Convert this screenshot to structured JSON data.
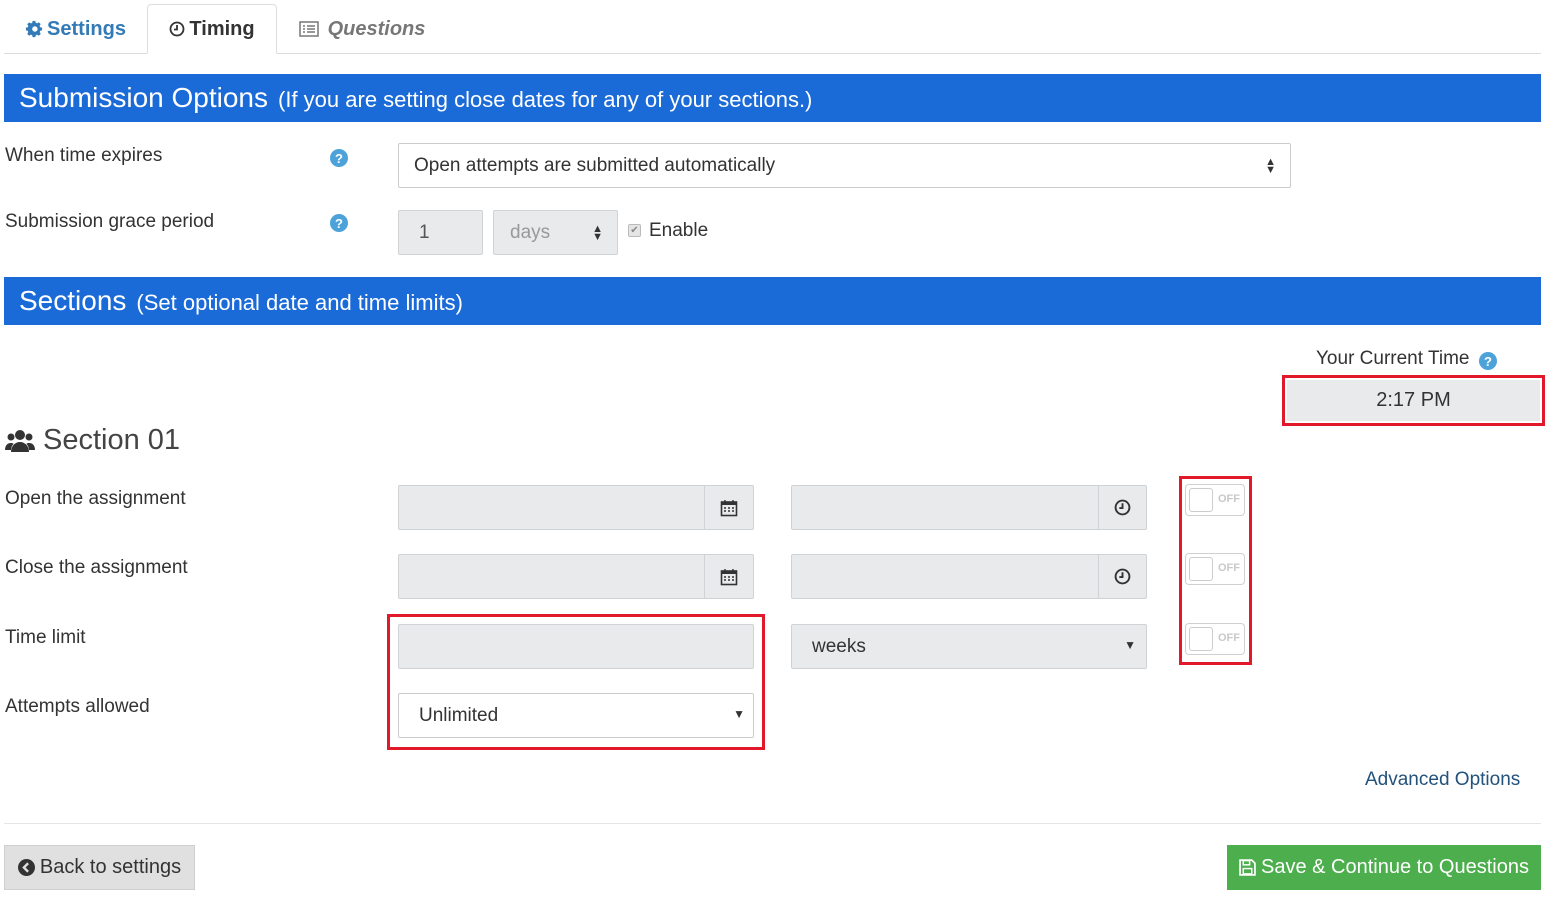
{
  "tabs": {
    "settings": "Settings",
    "timing": "Timing",
    "questions": "Questions"
  },
  "submission": {
    "title": "Submission Options",
    "subtitle": "(If you are setting close dates for any of your sections.)",
    "when_expires_label": "When time expires",
    "when_expires_value": "Open attempts are submitted automatically",
    "grace_label": "Submission grace period",
    "grace_value": "1",
    "grace_unit": "days",
    "enable_label": "Enable",
    "enable_checked": true
  },
  "sections": {
    "title": "Sections",
    "subtitle": "(Set optional date and time limits)",
    "current_time_label": "Your Current Time",
    "current_time_value": "2:17 PM",
    "section_name": "Section 01",
    "open_label": "Open the assignment",
    "close_label": "Close the assignment",
    "time_limit_label": "Time limit",
    "time_limit_unit": "weeks",
    "attempts_label": "Attempts allowed",
    "attempts_value": "Unlimited",
    "toggle_off": "OFF",
    "advanced_options": "Advanced Options"
  },
  "footer": {
    "back": "Back to settings",
    "save": "Save & Continue to Questions"
  },
  "colors": {
    "band": "#1a6ad8",
    "link": "#337ab7",
    "help": "#4da3d9",
    "highlight": "#e2192b",
    "save": "#4cae4c"
  }
}
